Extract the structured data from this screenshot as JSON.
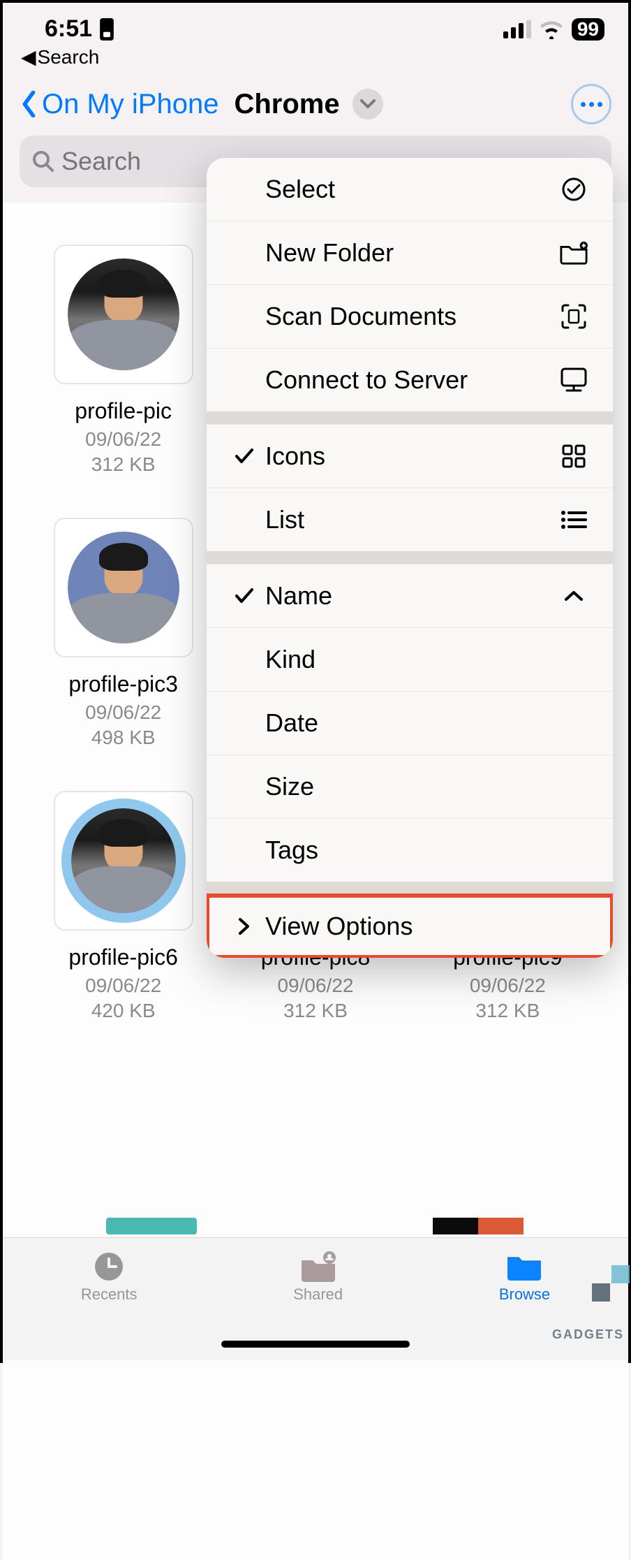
{
  "status": {
    "time": "6:51",
    "battery": "99",
    "back_app": "Search"
  },
  "nav": {
    "back_label": "On My iPhone",
    "title": "Chrome"
  },
  "search": {
    "placeholder": "Search"
  },
  "files": [
    {
      "name": "profile-pic",
      "date": "09/06/22",
      "size": "312 KB",
      "variant": "plain"
    },
    {
      "name": "profile-pic3",
      "date": "09/06/22",
      "size": "498 KB",
      "variant": "bluepat"
    },
    {
      "name": "profile-pic6",
      "date": "09/06/22",
      "size": "420 KB",
      "variant": "ring"
    },
    {
      "name": "profile-pic8",
      "date": "09/06/22",
      "size": "312 KB",
      "variant": "plain"
    },
    {
      "name": "profile-pic9",
      "date": "09/06/22",
      "size": "312 KB",
      "variant": "plain"
    }
  ],
  "menu": {
    "select": "Select",
    "new_folder": "New Folder",
    "scan_documents": "Scan Documents",
    "connect_server": "Connect to Server",
    "icons": "Icons",
    "list": "List",
    "name": "Name",
    "kind": "Kind",
    "date": "Date",
    "size": "Size",
    "tags": "Tags",
    "view_options": "View Options"
  },
  "tabs": {
    "recents": "Recents",
    "shared": "Shared",
    "browse": "Browse"
  },
  "watermark": "GADGETS"
}
